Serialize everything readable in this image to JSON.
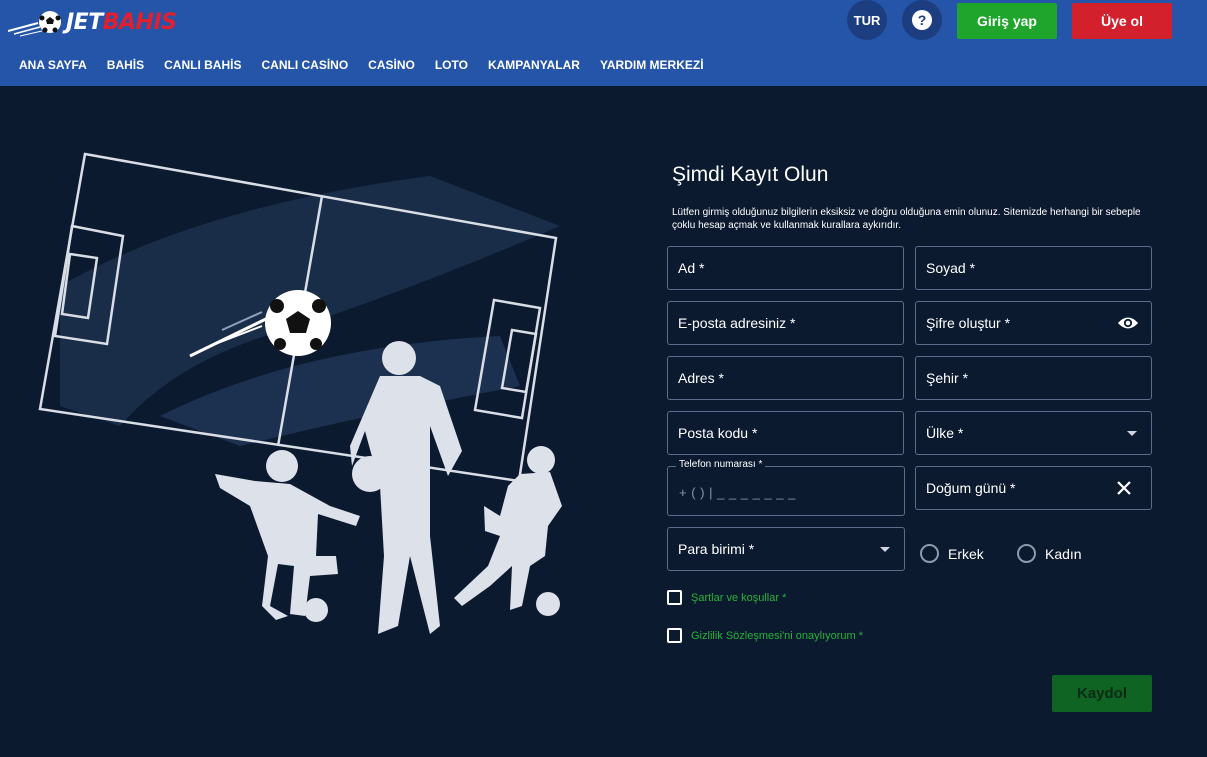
{
  "header": {
    "logo": {
      "part1": "JET",
      "part2": "BAHIS"
    },
    "nav": [
      "ANA SAYFA",
      "BAHİS",
      "CANLI BAHİS",
      "CANLI CASİNO",
      "CASİNO",
      "LOTO",
      "KAMPANYALAR",
      "YARDIM MERKEZİ"
    ],
    "lang": "TUR",
    "help_icon": "?",
    "login": "Giriş yap",
    "signup": "Üye ol"
  },
  "form": {
    "title": "Şimdi Kayıt Olun",
    "description": "Lütfen girmiş olduğunuz bilgilerin eksiksiz ve doğru olduğuna emin olunuz. Sitemizde herhangi bir sebeple çoklu hesap açmak ve kullanmak kurallara aykırıdır.",
    "first_name": "Ad *",
    "last_name": "Soyad *",
    "email": "E-posta adresiniz *",
    "password": "Şifre oluştur *",
    "address": "Adres *",
    "city": "Şehir *",
    "postal_code": "Posta kodu *",
    "country": "Ülke *",
    "phone_label": "Telefon numarası *",
    "phone_value": "+ (    ) |  _ _ _ _ _ _ _",
    "birthday": "Doğum günü *",
    "currency": "Para birimi *",
    "gender_male": "Erkek",
    "gender_female": "Kadın",
    "terms": "Şartlar ve koşullar *",
    "privacy": "Gizlilik Sözleşmesi'ni onaylıyorum *",
    "submit": "Kaydol"
  },
  "colors": {
    "header_bg": "#2555a8",
    "page_bg": "#0c1a30",
    "login_green": "#1fa52c",
    "signup_red": "#d3202d",
    "submit_green": "#0f6323",
    "link_green": "#27b23a"
  },
  "icons": [
    "soccer-ball-icon",
    "help-icon",
    "eye-icon",
    "chevron-down-icon",
    "close-icon"
  ]
}
